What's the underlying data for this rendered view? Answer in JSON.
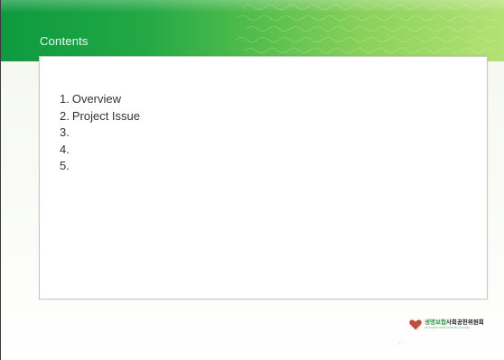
{
  "slide": {
    "title": "Contents",
    "toc": [
      {
        "num": "1.",
        "text": "Overview"
      },
      {
        "num": "2.",
        "text": "Project Issue"
      },
      {
        "num": "3.",
        "text": ""
      },
      {
        "num": "4.",
        "text": ""
      },
      {
        "num": "5.",
        "text": ""
      }
    ]
  },
  "logo": {
    "name_part1": "생명보험",
    "name_part2": "사회공헌위원회",
    "subtitle": "Life Insurance Social Contribution Committee",
    "mark_icon": "heart-icon"
  },
  "colors": {
    "header_green_dark": "#0d9a3f",
    "header_green_light": "#b4e274",
    "logo_heart": "#e23a36",
    "logo_green": "#2e9a3f"
  }
}
